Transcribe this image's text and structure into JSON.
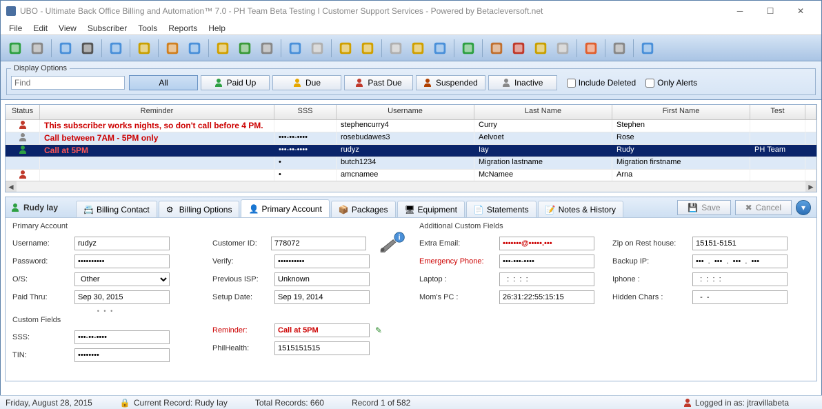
{
  "window": {
    "title": "UBO - Ultimate Back Office Billing and Automation™ 7.0 - PH Team Beta Testing I Customer Support Services - Powered by Betacleversoft.net"
  },
  "menu": [
    "File",
    "Edit",
    "View",
    "Subscriber",
    "Tools",
    "Reports",
    "Help"
  ],
  "toolbar_icons": [
    "add-user",
    "gear",
    "mail-in",
    "funnel",
    "clock",
    "shield",
    "contact",
    "user-card",
    "note",
    "globe",
    "wifi",
    "mail-out",
    "envelope",
    "note-add",
    "doc-add",
    "copy",
    "sheet",
    "chart",
    "tech",
    "box",
    "spam",
    "trash",
    "report",
    "lifebuoy",
    "user-del",
    "help"
  ],
  "display_options": {
    "legend": "Display Options",
    "find_placeholder": "Find",
    "filters": [
      {
        "label": "All",
        "active": true,
        "icon": null
      },
      {
        "label": "Paid Up",
        "icon": "#2ea043"
      },
      {
        "label": "Due",
        "icon": "#e6a700"
      },
      {
        "label": "Past Due",
        "icon": "#c0392b"
      },
      {
        "label": "Suspended",
        "icon": "#b04000"
      },
      {
        "label": "Inactive",
        "icon": "#888"
      }
    ],
    "include_deleted": "Include Deleted",
    "only_alerts": "Only Alerts"
  },
  "grid": {
    "headers": [
      "Status",
      "Reminder",
      "SSS",
      "Username",
      "Last Name",
      "First Name",
      "Test"
    ],
    "rows": [
      {
        "status": "#c0392b",
        "reminder": "This subscriber works nights, so don't call before 4 PM.",
        "reminder_red": true,
        "sss": "",
        "username": "stephencurry4",
        "last": "Curry",
        "first": "Stephen",
        "test": ""
      },
      {
        "status": "#888",
        "reminder": "Call between 7AM - 5PM only",
        "reminder_red": true,
        "sss": "•••-••-••••",
        "username": "rosebudawes3",
        "last": "Aelvoet",
        "first": "Rose",
        "test": ""
      },
      {
        "status": "#2ea043",
        "reminder": "Call at 5PM",
        "reminder_red": true,
        "sss": "•••-••-••••",
        "username": "rudyz",
        "last": "Iay",
        "first": "Rudy",
        "test": "PH Team",
        "selected": true
      },
      {
        "status": "",
        "reminder": "",
        "reminder_red": false,
        "sss": "•",
        "username": "butch1234",
        "last": "Migration lastname",
        "first": "Migration firstname",
        "test": ""
      },
      {
        "status": "#c0392b",
        "reminder": "",
        "reminder_red": false,
        "sss": "•",
        "username": "amcnamee",
        "last": "McNamee",
        "first": "Arna",
        "test": ""
      }
    ]
  },
  "detail": {
    "name": "Rudy Iay",
    "tabs": [
      "Billing Contact",
      "Billing Options",
      "Primary Account",
      "Packages",
      "Equipment",
      "Statements",
      "Notes & History"
    ],
    "active_tab": 2,
    "save": "Save",
    "cancel": "Cancel",
    "primary_account": {
      "title": "Primary Account",
      "username_l": "Username:",
      "username": "rudyz",
      "password_l": "Password:",
      "password": "••••••••••",
      "os_l": "O/S:",
      "os": "Other",
      "paid_l": "Paid Thru:",
      "paid": "Sep 30, 2015",
      "cust_l": "Customer ID:",
      "cust": "778072",
      "verify_l": "Verify:",
      "verify": "••••••••••",
      "pisp_l": "Previous ISP:",
      "pisp": "Unknown",
      "setup_l": "Setup Date:",
      "setup": "Sep 19, 2014"
    },
    "custom_fields": {
      "title": "Custom Fields",
      "sss_l": "SSS:",
      "sss": "•••-••-••••",
      "tin_l": "TIN:",
      "tin": "••••••••",
      "reminder_l": "Reminder:",
      "reminder": "Call at 5PM",
      "phil_l": "PhilHealth:",
      "phil": "1515151515"
    },
    "additional": {
      "title": "Additional Custom Fields",
      "extra_l": "Extra Email:",
      "extra": "•••••••@•••••.•••",
      "emerg_l": "Emergency Phone:",
      "emerg": "•••-•••-••••",
      "laptop_l": "Laptop :",
      "laptop": "  :  :  :  :  ",
      "mom_l": "Mom's PC :",
      "mom": "26:31:22:55:15:15",
      "zip_l": "Zip on Rest house:",
      "zip": "15151-5151",
      "backup_l": "Backup IP:",
      "backup": "•••  .  •••  .  •••  .  •••",
      "iphone_l": "Iphone :",
      "iphone": "  :  :  :  :  ",
      "hidden_l": "Hidden Chars :",
      "hidden": "  -  -"
    }
  },
  "statusbar": {
    "date": "Friday, August 28, 2015",
    "current": "Current Record: Rudy Iay",
    "total": "Total Records: 660",
    "record": "Record 1 of 582",
    "logged": "Logged in as: jtravillabeta"
  }
}
